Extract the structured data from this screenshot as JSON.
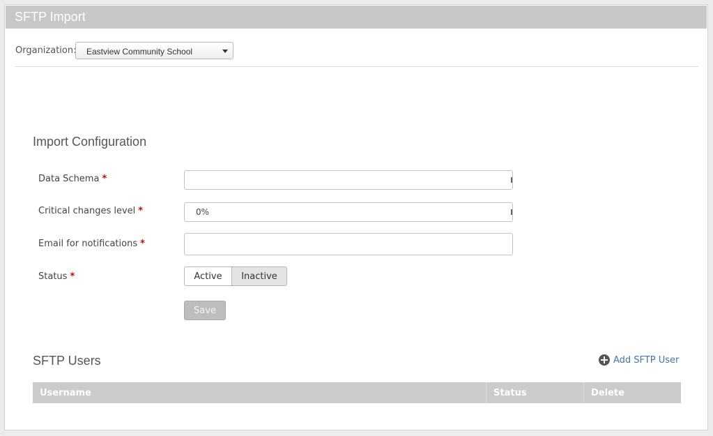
{
  "header": {
    "title": "SFTP Import"
  },
  "organization": {
    "label": "Organization:",
    "selected": "Eastview Community School"
  },
  "import_config": {
    "title": "Import Configuration",
    "fields": {
      "data_schema": {
        "label": "Data Schema",
        "required": "*",
        "value": ""
      },
      "critical_changes": {
        "label": "Critical changes level",
        "required": "*",
        "value": "0%"
      },
      "email": {
        "label": "Email for notifications",
        "required": "*",
        "value": ""
      },
      "status": {
        "label": "Status",
        "required": "*",
        "options": [
          "Active",
          "Inactive"
        ],
        "selected": "Inactive"
      }
    },
    "save_label": "Save"
  },
  "sftp_users": {
    "title": "SFTP Users",
    "add_label": "Add SFTP User",
    "columns": [
      "Username",
      "Status",
      "Delete"
    ]
  }
}
